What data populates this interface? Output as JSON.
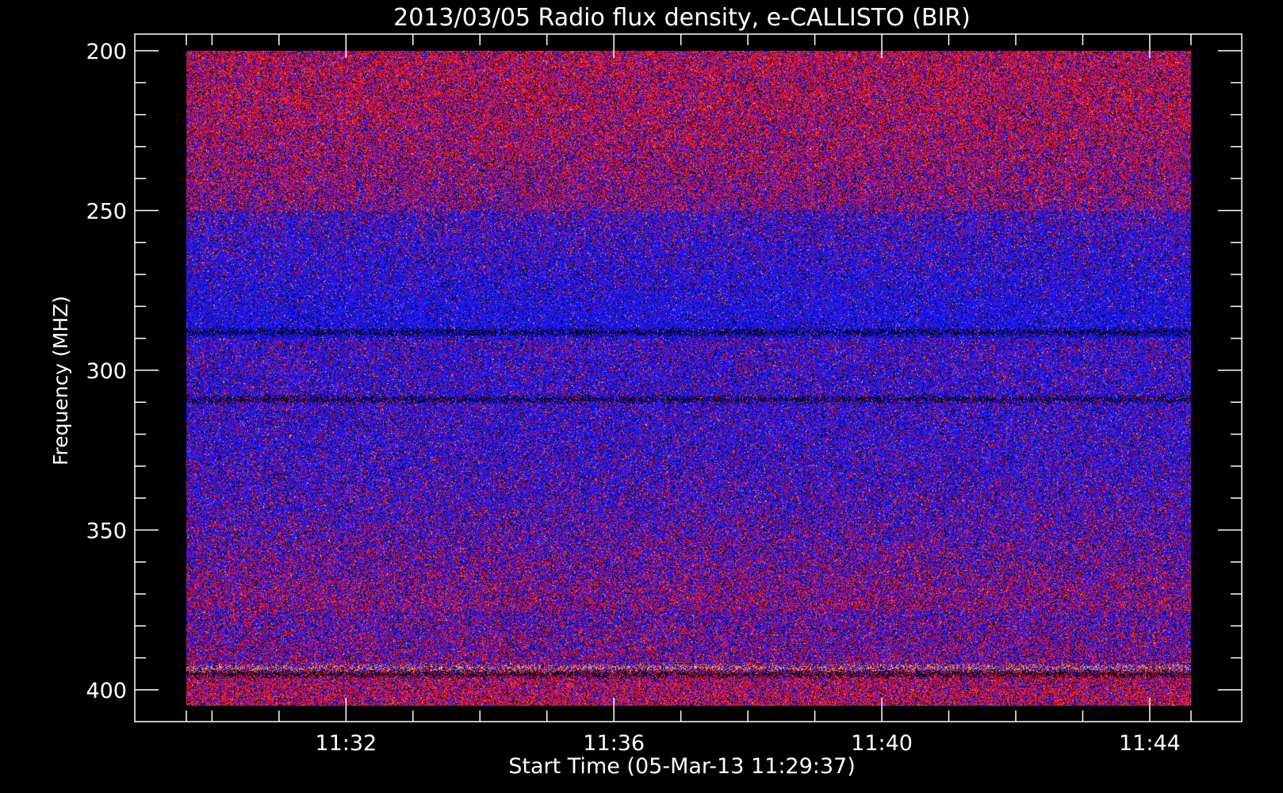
{
  "chart_data": {
    "type": "heatmap",
    "title": "2013/03/05  Radio flux density, e-CALLISTO (BIR)",
    "xlabel": "Start Time (05-Mar-13 11:29:37)",
    "ylabel": "Frequency (MHZ)",
    "x_start": "11:29:37",
    "x_end": "11:44:37",
    "x_major_ticks": [
      "11:32",
      "11:36",
      "11:40",
      "11:44"
    ],
    "x_minor_tick_interval_min": 1,
    "ylim": [
      200,
      405
    ],
    "y_inverted": true,
    "y_major_ticks": [
      200,
      250,
      300,
      350,
      400
    ],
    "y_minor_tick_interval": 10,
    "colormap": [
      "#000000",
      "#3a0a8a",
      "#1a1aff",
      "#ff1a1a",
      "#ffb060"
    ],
    "background_color": "#000000",
    "frame_color": "#ffffff",
    "notable_features": [
      {
        "kind": "dark band",
        "frequency_mhz": 288
      },
      {
        "kind": "dark band",
        "frequency_mhz": 309
      },
      {
        "kind": "bright band",
        "frequency_mhz": 393
      },
      {
        "kind": "dark band",
        "frequency_mhz": 395
      }
    ]
  }
}
